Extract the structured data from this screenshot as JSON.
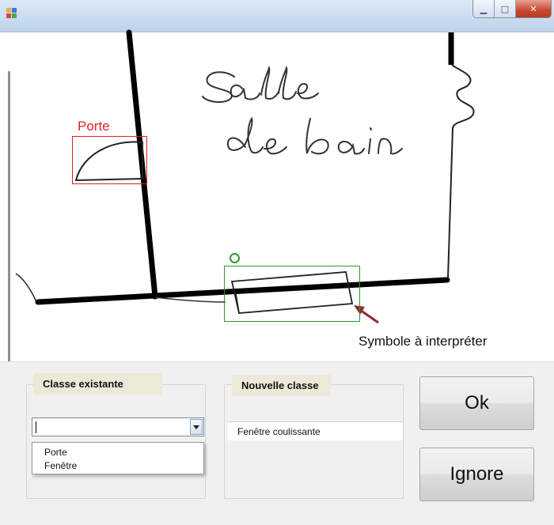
{
  "window": {
    "icon": "app-icon",
    "controls": {
      "minimize_glyph": "▁",
      "maximize_glyph": "□",
      "close_glyph": "✕"
    }
  },
  "canvas": {
    "drawing_text": [
      "Salle",
      "de bain"
    ],
    "detected_label": "Porte",
    "detected_color": "#e02020",
    "candidate_color": "#2e9a2e",
    "arrow_color": "#8b2e2e",
    "symbol_caption": "Symbole à interpréter"
  },
  "existing_class_group": {
    "title": "Classe existante",
    "combo_value": "",
    "options": [
      "Porte",
      "Fenêtre"
    ]
  },
  "new_class_group": {
    "title": "Nouvelle classe",
    "value": "Fenêtre coulissante"
  },
  "buttons": {
    "ok": "Ok",
    "ignore": "Ignore"
  }
}
